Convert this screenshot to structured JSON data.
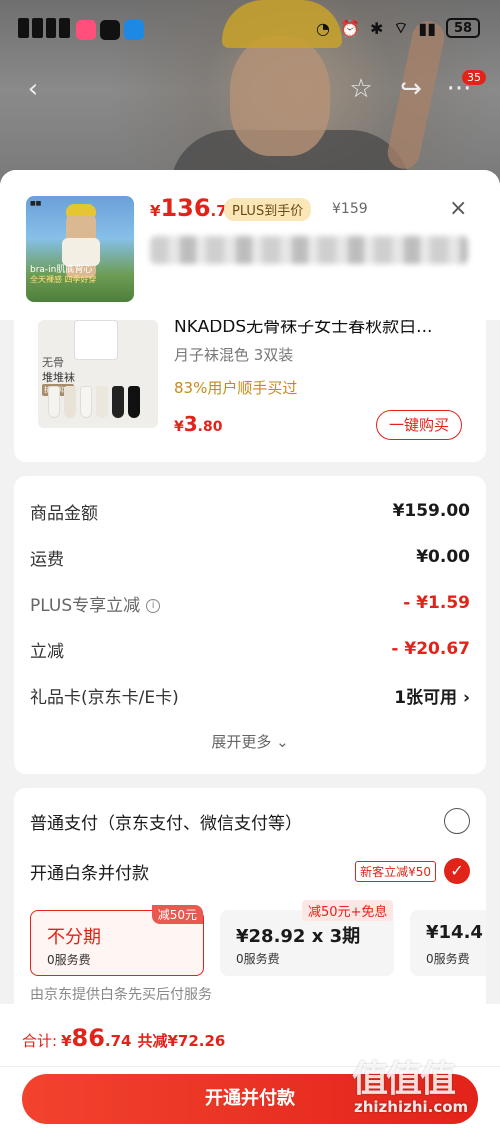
{
  "status_bar": {
    "battery": "58"
  },
  "top_nav": {
    "notification_count": "35"
  },
  "product_header": {
    "price_currency": "¥",
    "price_int": "136",
    "price_dec": ".74",
    "plus_tag": "PLUS到手价",
    "original_price": "¥159",
    "close": "×",
    "thumb_caption1": "bra-in肌底背心",
    "thumb_caption2": "全天裸感 四季好穿"
  },
  "addon_item": {
    "name": "NKADDS无骨袜子女士春秋款白...",
    "spec": "月子袜混色 3双装",
    "bought_text": "83%用户顺手买过",
    "price_currency": "¥",
    "price_int": "3",
    "price_dec": ".80",
    "buy_label": "一键购买",
    "image_text1": "无骨",
    "image_text2": "堆堆袜",
    "image_text3": "抗菌抑菌"
  },
  "summary": {
    "rows": [
      {
        "label": "商品金额",
        "value": "¥159.00"
      },
      {
        "label": "运费",
        "value": "¥0.00"
      },
      {
        "label": "PLUS专享立减",
        "value": "- ¥1.59"
      },
      {
        "label": "立减",
        "value": "- ¥20.67"
      },
      {
        "label": "礼品卡(京东卡/E卡)",
        "value": "1张可用"
      }
    ],
    "expand_more": "展开更多"
  },
  "payment": {
    "normal_label": "普通支付（京东支付、微信支付等）",
    "baitiao_label": "开通白条并付款",
    "new_customer_tag": "新客立减¥50",
    "plans": [
      {
        "main": "不分期",
        "sub": "0服务费",
        "tag": "减50元"
      },
      {
        "main": "¥28.92 x 3期",
        "sub": "0服务费",
        "tag": "减50元+免息"
      },
      {
        "main": "¥14.4",
        "sub": "0服务费"
      }
    ],
    "description": "由京东提供白条先买后付服务"
  },
  "footer": {
    "total_label": "合计:",
    "total_currency": "¥",
    "total_int": "86",
    "total_dec": ".74",
    "saved": "共减¥72.26",
    "cta": "开通并付款"
  },
  "watermark": {
    "logo": "值值值",
    "site": "zhizhizhi.com"
  },
  "colors": {
    "accent": "#e2231a",
    "plus_bg": "#fbe6b8",
    "bought": "#c78a1a"
  }
}
